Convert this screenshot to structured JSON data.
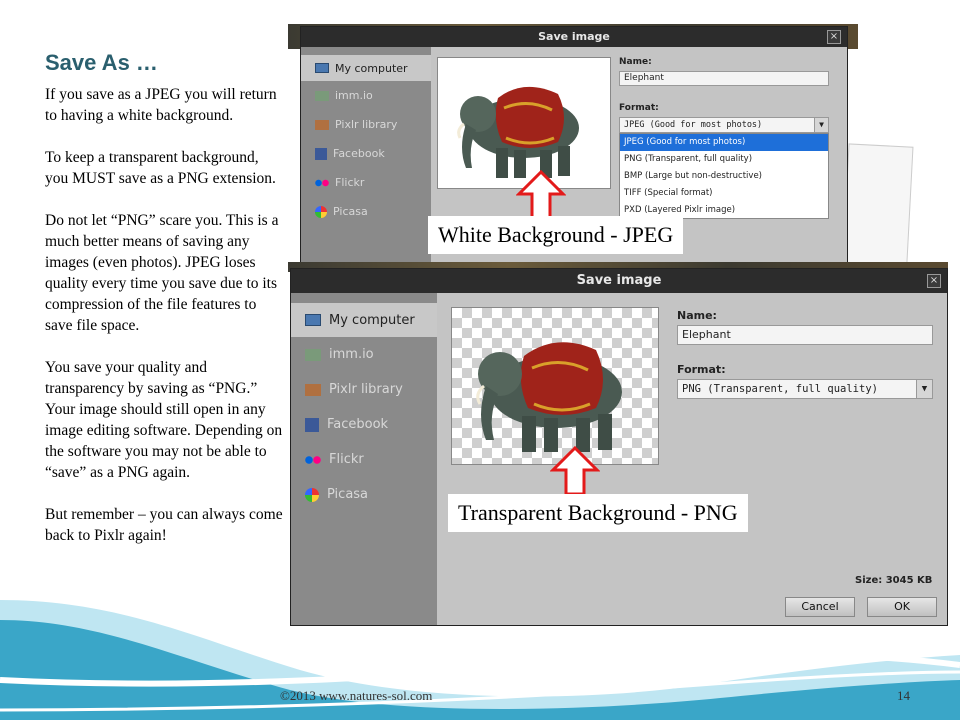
{
  "slide": {
    "title": "Save As …",
    "paragraphs": [
      "If you save as a JPEG you will return to having a white background.",
      "To keep a transparent background, you MUST save as a PNG extension.",
      "Do not let “PNG” scare you. This is a much better means of saving any images (even photos). JPEG loses quality every time you save due to its compression of the file features to save file space.",
      "You save your quality and transparency by saving as “PNG.” Your image should still open in any image editing software.  Depending on the software you may not be able to “save” as a PNG again.",
      "But remember – you can always come back to Pixlr again!"
    ],
    "footer": "©2013 www.natures-sol.com",
    "page_number": "14"
  },
  "dialog_jpeg": {
    "title": "Save image",
    "close": "×",
    "sidebar": [
      "My computer",
      "imm.io",
      "Pixlr library",
      "Facebook",
      "Flickr",
      "Picasa"
    ],
    "name_label": "Name:",
    "name_value": "Elephant",
    "format_label": "Format:",
    "format_value": "JPEG (Good for most photos)",
    "format_options": [
      "JPEG (Good for most photos)",
      "PNG (Transparent, full quality)",
      "BMP (Large but non-destructive)",
      "TIFF (Special format)",
      "PXD (Layered Pixlr image)"
    ],
    "callout": "White Background - JPEG"
  },
  "dialog_png": {
    "title": "Save image",
    "close": "×",
    "sidebar": [
      "My computer",
      "imm.io",
      "Pixlr library",
      "Facebook",
      "Flickr",
      "Picasa"
    ],
    "name_label": "Name:",
    "name_value": "Elephant",
    "format_label": "Format:",
    "format_value": "PNG (Transparent, full quality)",
    "size_text": "Size: 3045 KB",
    "cancel": "Cancel",
    "ok": "OK",
    "callout": "Transparent Background - PNG"
  },
  "colors": {
    "title": "#2a5f6e",
    "wave_dark": "#3aa6c8",
    "wave_light": "#bfe6f2",
    "callout_arrow": "#e31a1a",
    "selected_option": "#1e6fd9"
  }
}
